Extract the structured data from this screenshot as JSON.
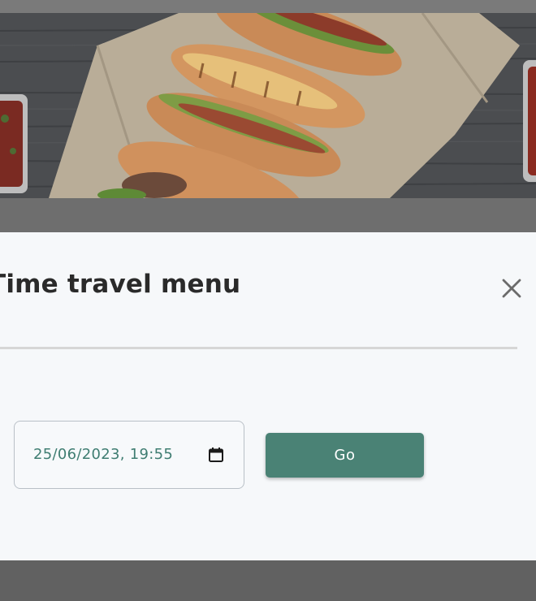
{
  "modal": {
    "title": "Time travel menu",
    "close_icon": "close-icon"
  },
  "time_picker": {
    "value": "25/06/2023, 19:55",
    "icon": "calendar-icon",
    "text_color": "#3f7d72"
  },
  "go_button": {
    "label": "Go",
    "color": "#4a8275"
  },
  "hero_image": {
    "subject": "hot-dogs-on-wood-table"
  }
}
